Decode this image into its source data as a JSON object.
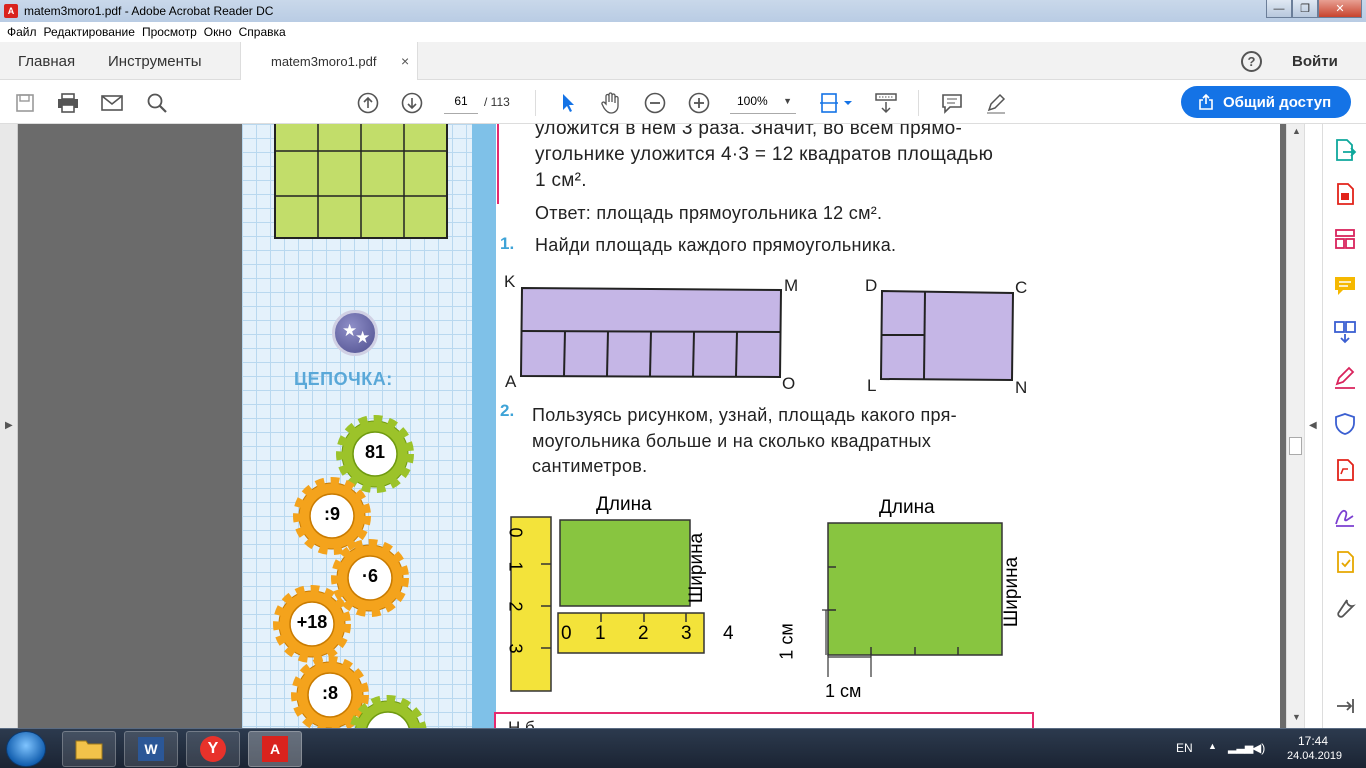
{
  "window": {
    "title": "matem3moro1.pdf - Adobe Acrobat Reader DC"
  },
  "menu": [
    "Файл",
    "Редактирование",
    "Просмотр",
    "Окно",
    "Справка"
  ],
  "tabs": {
    "home": "Главная",
    "tools": "Инструменты",
    "doc": "matem3moro1.pdf",
    "close": "×"
  },
  "header": {
    "help": "?",
    "signin": "Войти"
  },
  "toolbar": {
    "page_current": "61",
    "page_total": "/ 113",
    "zoom": "100%"
  },
  "share": {
    "label": "Общий доступ"
  },
  "content": {
    "line1": "уложится в нем 3 раза. Значит, во всем прямо-",
    "line2": "угольнике уложится  4·3 = 12  квадратов площадью",
    "line3": "1  см².",
    "answer": "Ответ:  площадь  прямоугольника  12  см².",
    "task1_num": "1.",
    "task1": "Найди  площадь  каждого  прямоугольника.",
    "task2_num": "2.",
    "task2_l1": "Пользуясь  рисунком,  узнай,  площадь  какого  пря-",
    "task2_l2": "моугольника  больше  и  на  сколько  квадратных",
    "task2_l3": "сантиметров.",
    "chain_title": "ЦЕПОЧКА:",
    "gears": [
      "81",
      ":9",
      "·6",
      "+18",
      ":8"
    ],
    "fig1_labels": {
      "k": "K",
      "m": "M",
      "a": "A",
      "o": "O"
    },
    "fig2_labels": {
      "d": "D",
      "c": "C",
      "l": "L",
      "n": "N"
    },
    "dlina": "Длина",
    "shirina": "Ширина",
    "ruler_v": [
      "0",
      "1",
      "2",
      "3"
    ],
    "ruler_h": [
      "0",
      "1",
      "2",
      "3",
      "4"
    ],
    "one_cm": "1 см",
    "bottom_partial": "Н  б"
  },
  "taskbar": {
    "lang": "EN",
    "time": "17:44",
    "date": "24.04.2019"
  }
}
